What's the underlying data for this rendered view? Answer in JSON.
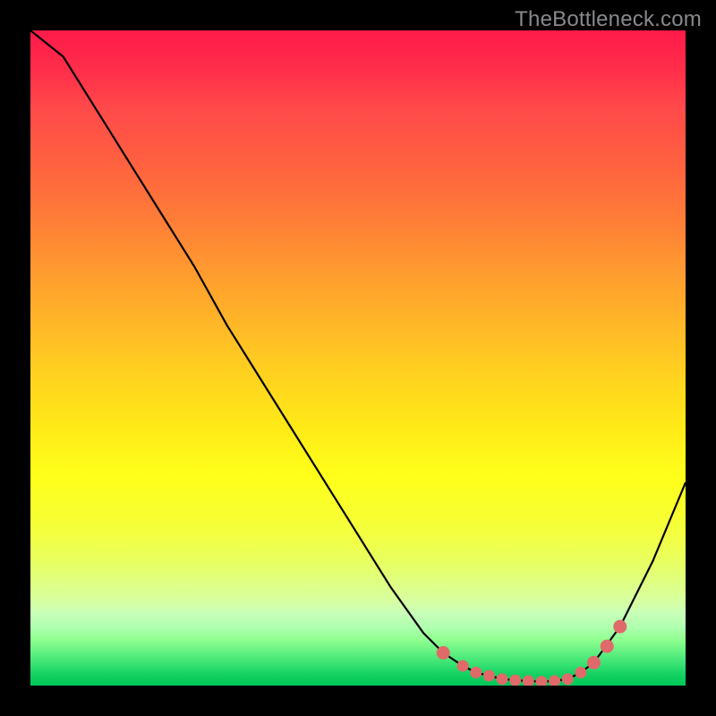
{
  "watermark": "TheBottleneck.com",
  "colors": {
    "curve_stroke": "#000000",
    "marker_fill": "#e06a6a",
    "marker_stroke": "#e06a6a",
    "background": "#000000"
  },
  "chart_data": {
    "type": "line",
    "title": "",
    "xlabel": "",
    "ylabel": "",
    "xlim": [
      0,
      100
    ],
    "ylim": [
      0,
      100
    ],
    "series": [
      {
        "name": "bottleneck-curve",
        "x": [
          0,
          5,
          10,
          15,
          20,
          25,
          30,
          35,
          40,
          45,
          50,
          55,
          60,
          63,
          66,
          68,
          70,
          72,
          74,
          76,
          78,
          80,
          82,
          84,
          86,
          90,
          95,
          100
        ],
        "y": [
          100,
          96,
          88,
          80,
          72,
          64,
          55,
          47,
          39,
          31,
          23,
          15,
          8,
          5,
          3,
          2,
          1.5,
          1,
          0.8,
          0.7,
          0.6,
          0.7,
          1,
          2,
          3.5,
          9,
          19,
          31
        ]
      }
    ],
    "markers": {
      "name": "highlight-points",
      "x": [
        63,
        66,
        68,
        70,
        72,
        74,
        76,
        78,
        80,
        82,
        84,
        86,
        88,
        90
      ],
      "y": [
        5,
        3,
        2,
        1.5,
        1,
        0.8,
        0.7,
        0.6,
        0.7,
        1,
        2,
        3.5,
        6,
        9
      ]
    }
  }
}
